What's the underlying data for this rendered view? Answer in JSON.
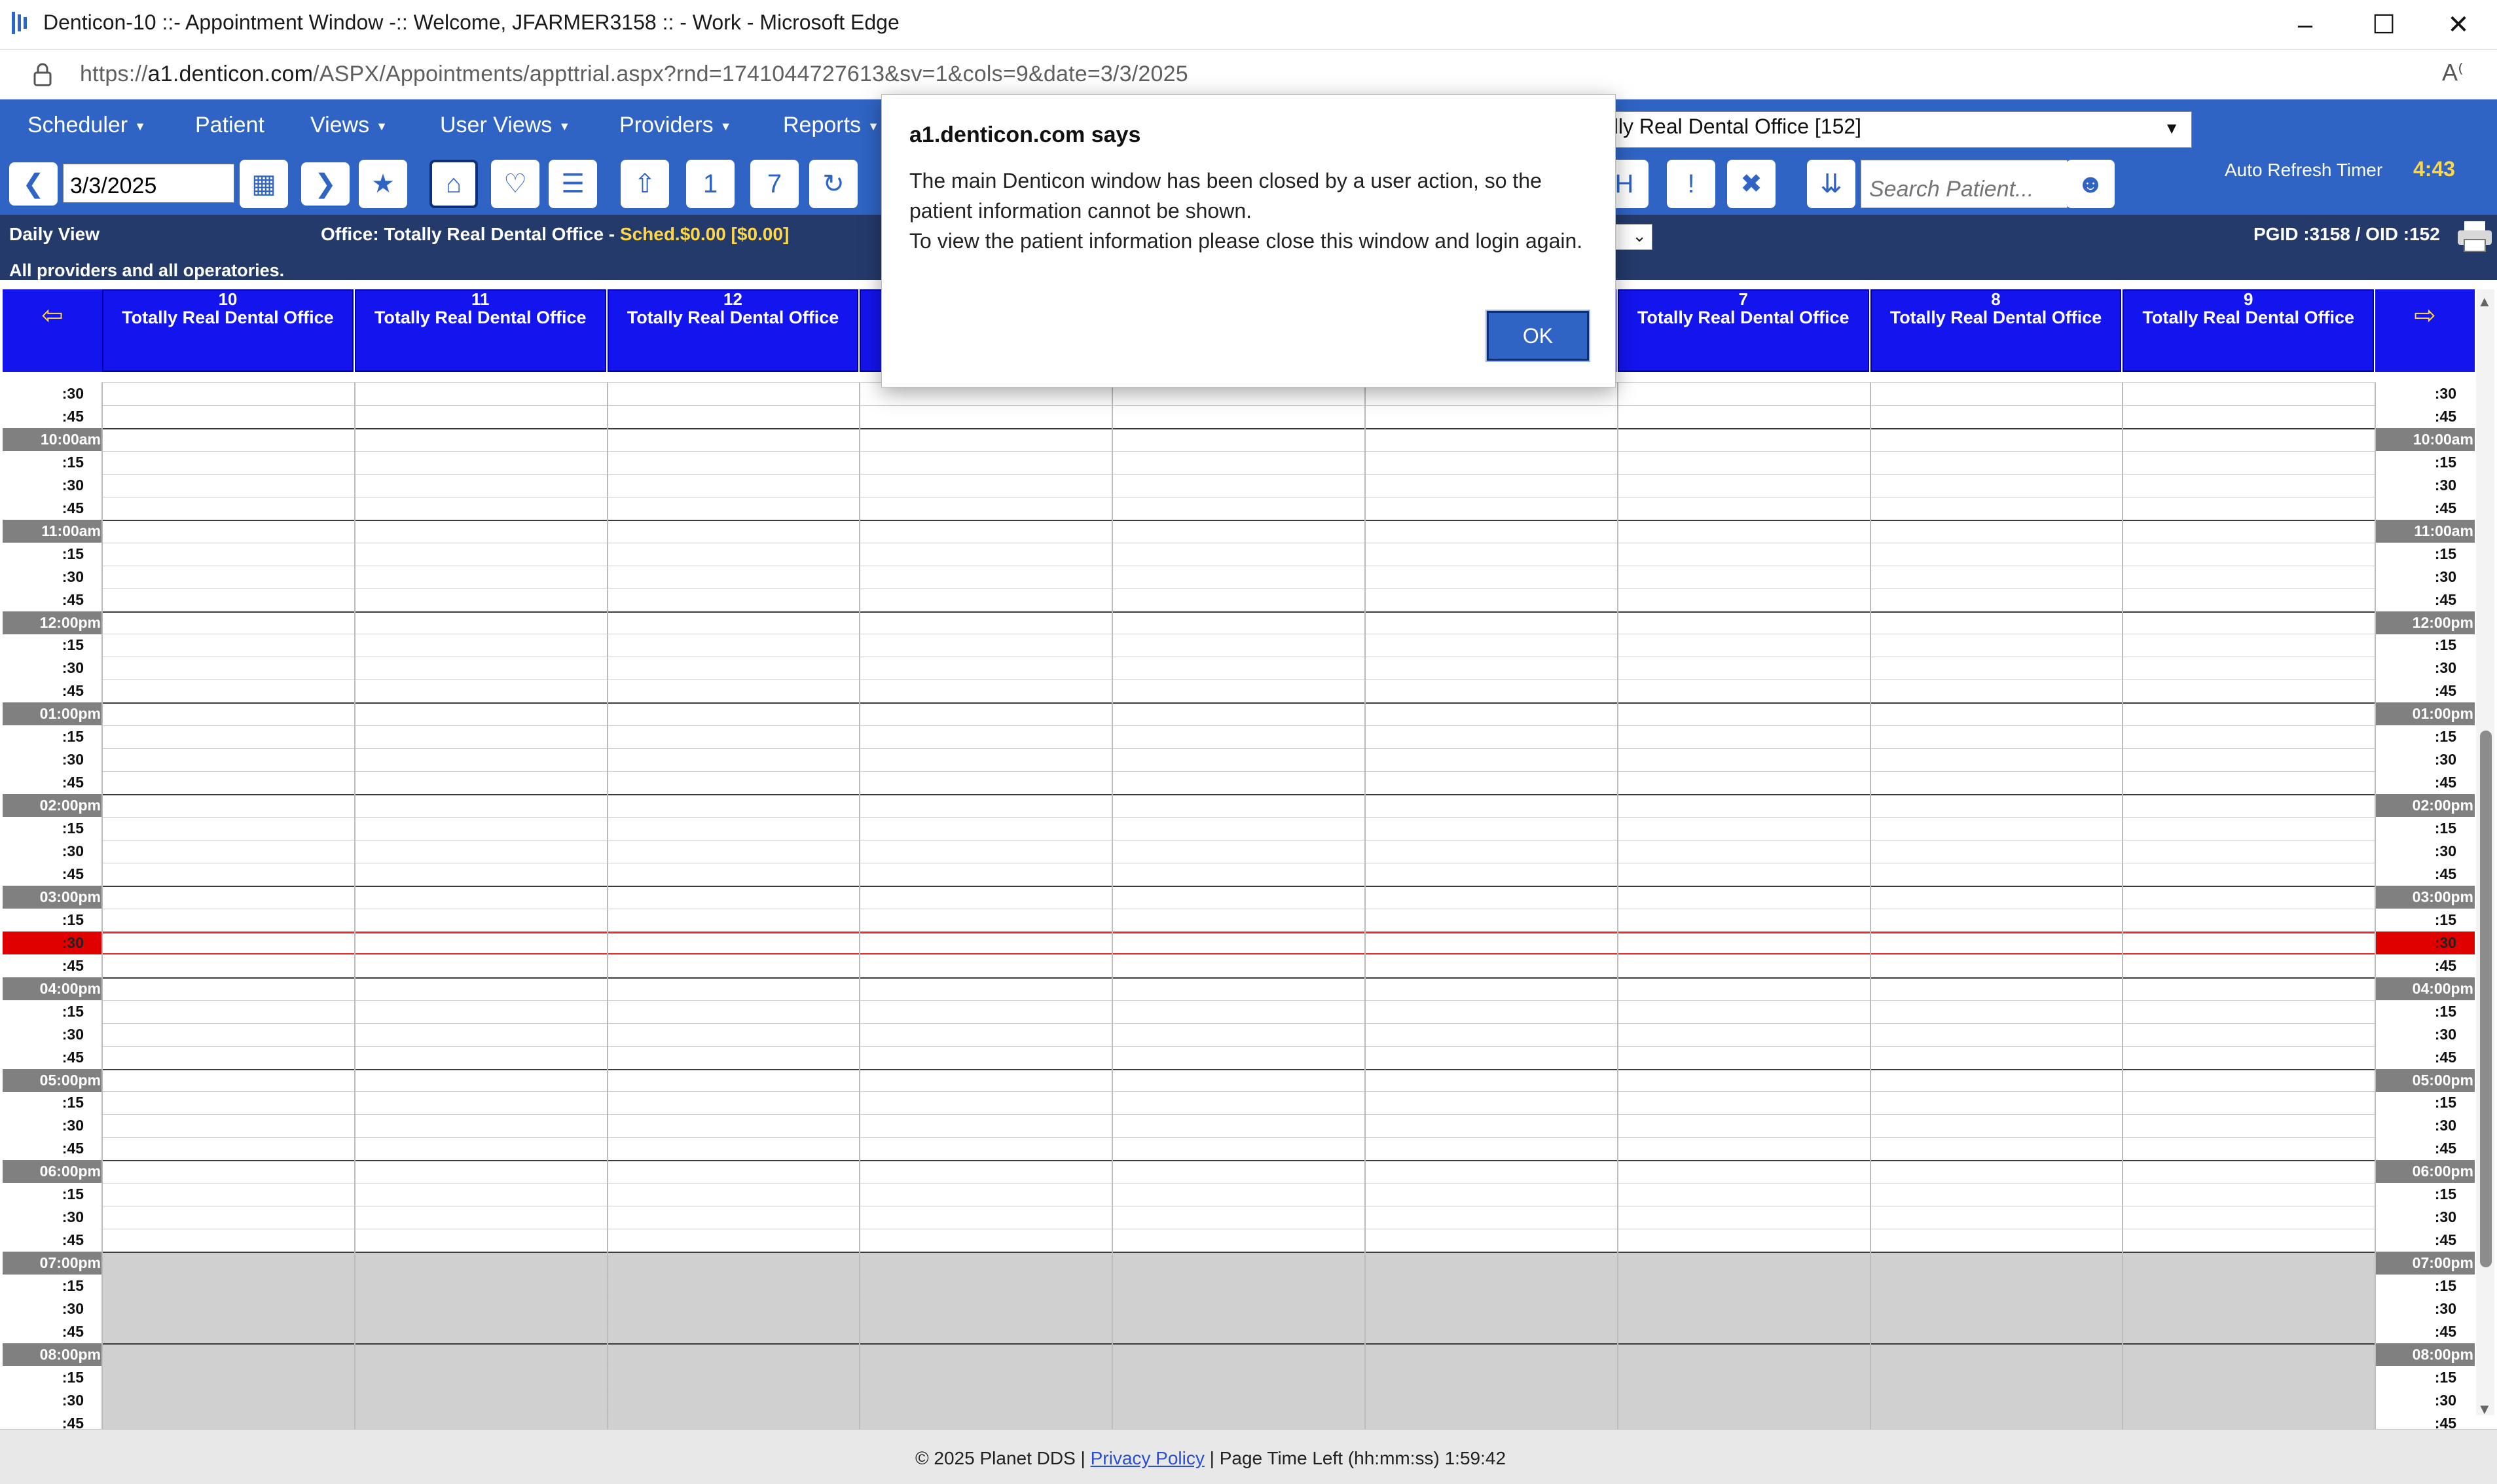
{
  "window": {
    "title": "Denticon-10 ::- Appointment Window -:: Welcome, JFARMER3158 :: - Work - Microsoft Edge",
    "url_prefix": "https://",
    "url_host": "a1.denticon.com",
    "url_path": "/ASPX/Appointments/appttrial.aspx?rnd=1741044727613&sv=1&cols=9&date=3/3/2025"
  },
  "menu": {
    "items": [
      "Scheduler",
      "Patient",
      "Views",
      "User Views",
      "Providers",
      "Reports"
    ],
    "office_select": "ally Real Dental Office [152]"
  },
  "toolbar": {
    "date": "3/3/2025",
    "search_placeholder": "Search Patient...",
    "refresh_label": "Auto Refresh Timer",
    "refresh_time": "4:43"
  },
  "info": {
    "view": "Daily View",
    "office_prefix": "Office: Totally Real Dental Office - ",
    "sched": "Sched.$0.00 [$0.00]",
    "ids": "PGID :3158  /  OID :152",
    "scope": "All providers and all operatories."
  },
  "columns": [
    {
      "num": "10",
      "name": "Totally Real Dental Office"
    },
    {
      "num": "11",
      "name": "Totally Real Dental Office"
    },
    {
      "num": "12",
      "name": "Totally Real Dental Office"
    },
    {
      "num": "",
      "name": ""
    },
    {
      "num": "",
      "name": ""
    },
    {
      "num": "",
      "name": ""
    },
    {
      "num": "7",
      "name": "Totally Real Dental Office"
    },
    {
      "num": "8",
      "name": "Totally Real Dental Office"
    },
    {
      "num": "9",
      "name": "Totally Real Dental Office"
    }
  ],
  "time_slots": [
    ":30",
    ":45",
    "10:00am",
    ":15",
    ":30",
    ":45",
    "11:00am",
    ":15",
    ":30",
    ":45",
    "12:00pm",
    ":15",
    ":30",
    ":45",
    "01:00pm",
    ":15",
    ":30",
    ":45",
    "02:00pm",
    ":15",
    ":30",
    ":45",
    "03:00pm",
    ":15",
    ":30",
    ":45",
    "04:00pm",
    ":15",
    ":30",
    ":45",
    "05:00pm",
    ":15",
    ":30",
    ":45",
    "06:00pm",
    ":15",
    ":30",
    ":45",
    "07:00pm",
    ":15",
    ":30",
    ":45",
    "08:00pm",
    ":15",
    ":30",
    ":45"
  ],
  "footer": {
    "copyright": "© 2025 Planet DDS | ",
    "privacy": "Privacy Policy",
    "time_left": " |  Page Time Left (hh:mm:ss) 1:59:42"
  },
  "dialog": {
    "heading": "a1.denticon.com says",
    "line1": "The main Denticon window has been closed by a user action, so the patient information cannot be shown.",
    "line2": "To view the patient information please close this window and login again.",
    "ok": "OK"
  },
  "colors": {
    "menu_bg": "#2f64c4",
    "column_header": "#1414ee",
    "current_time": "#e00000",
    "sched_text": "#ffd84a"
  }
}
